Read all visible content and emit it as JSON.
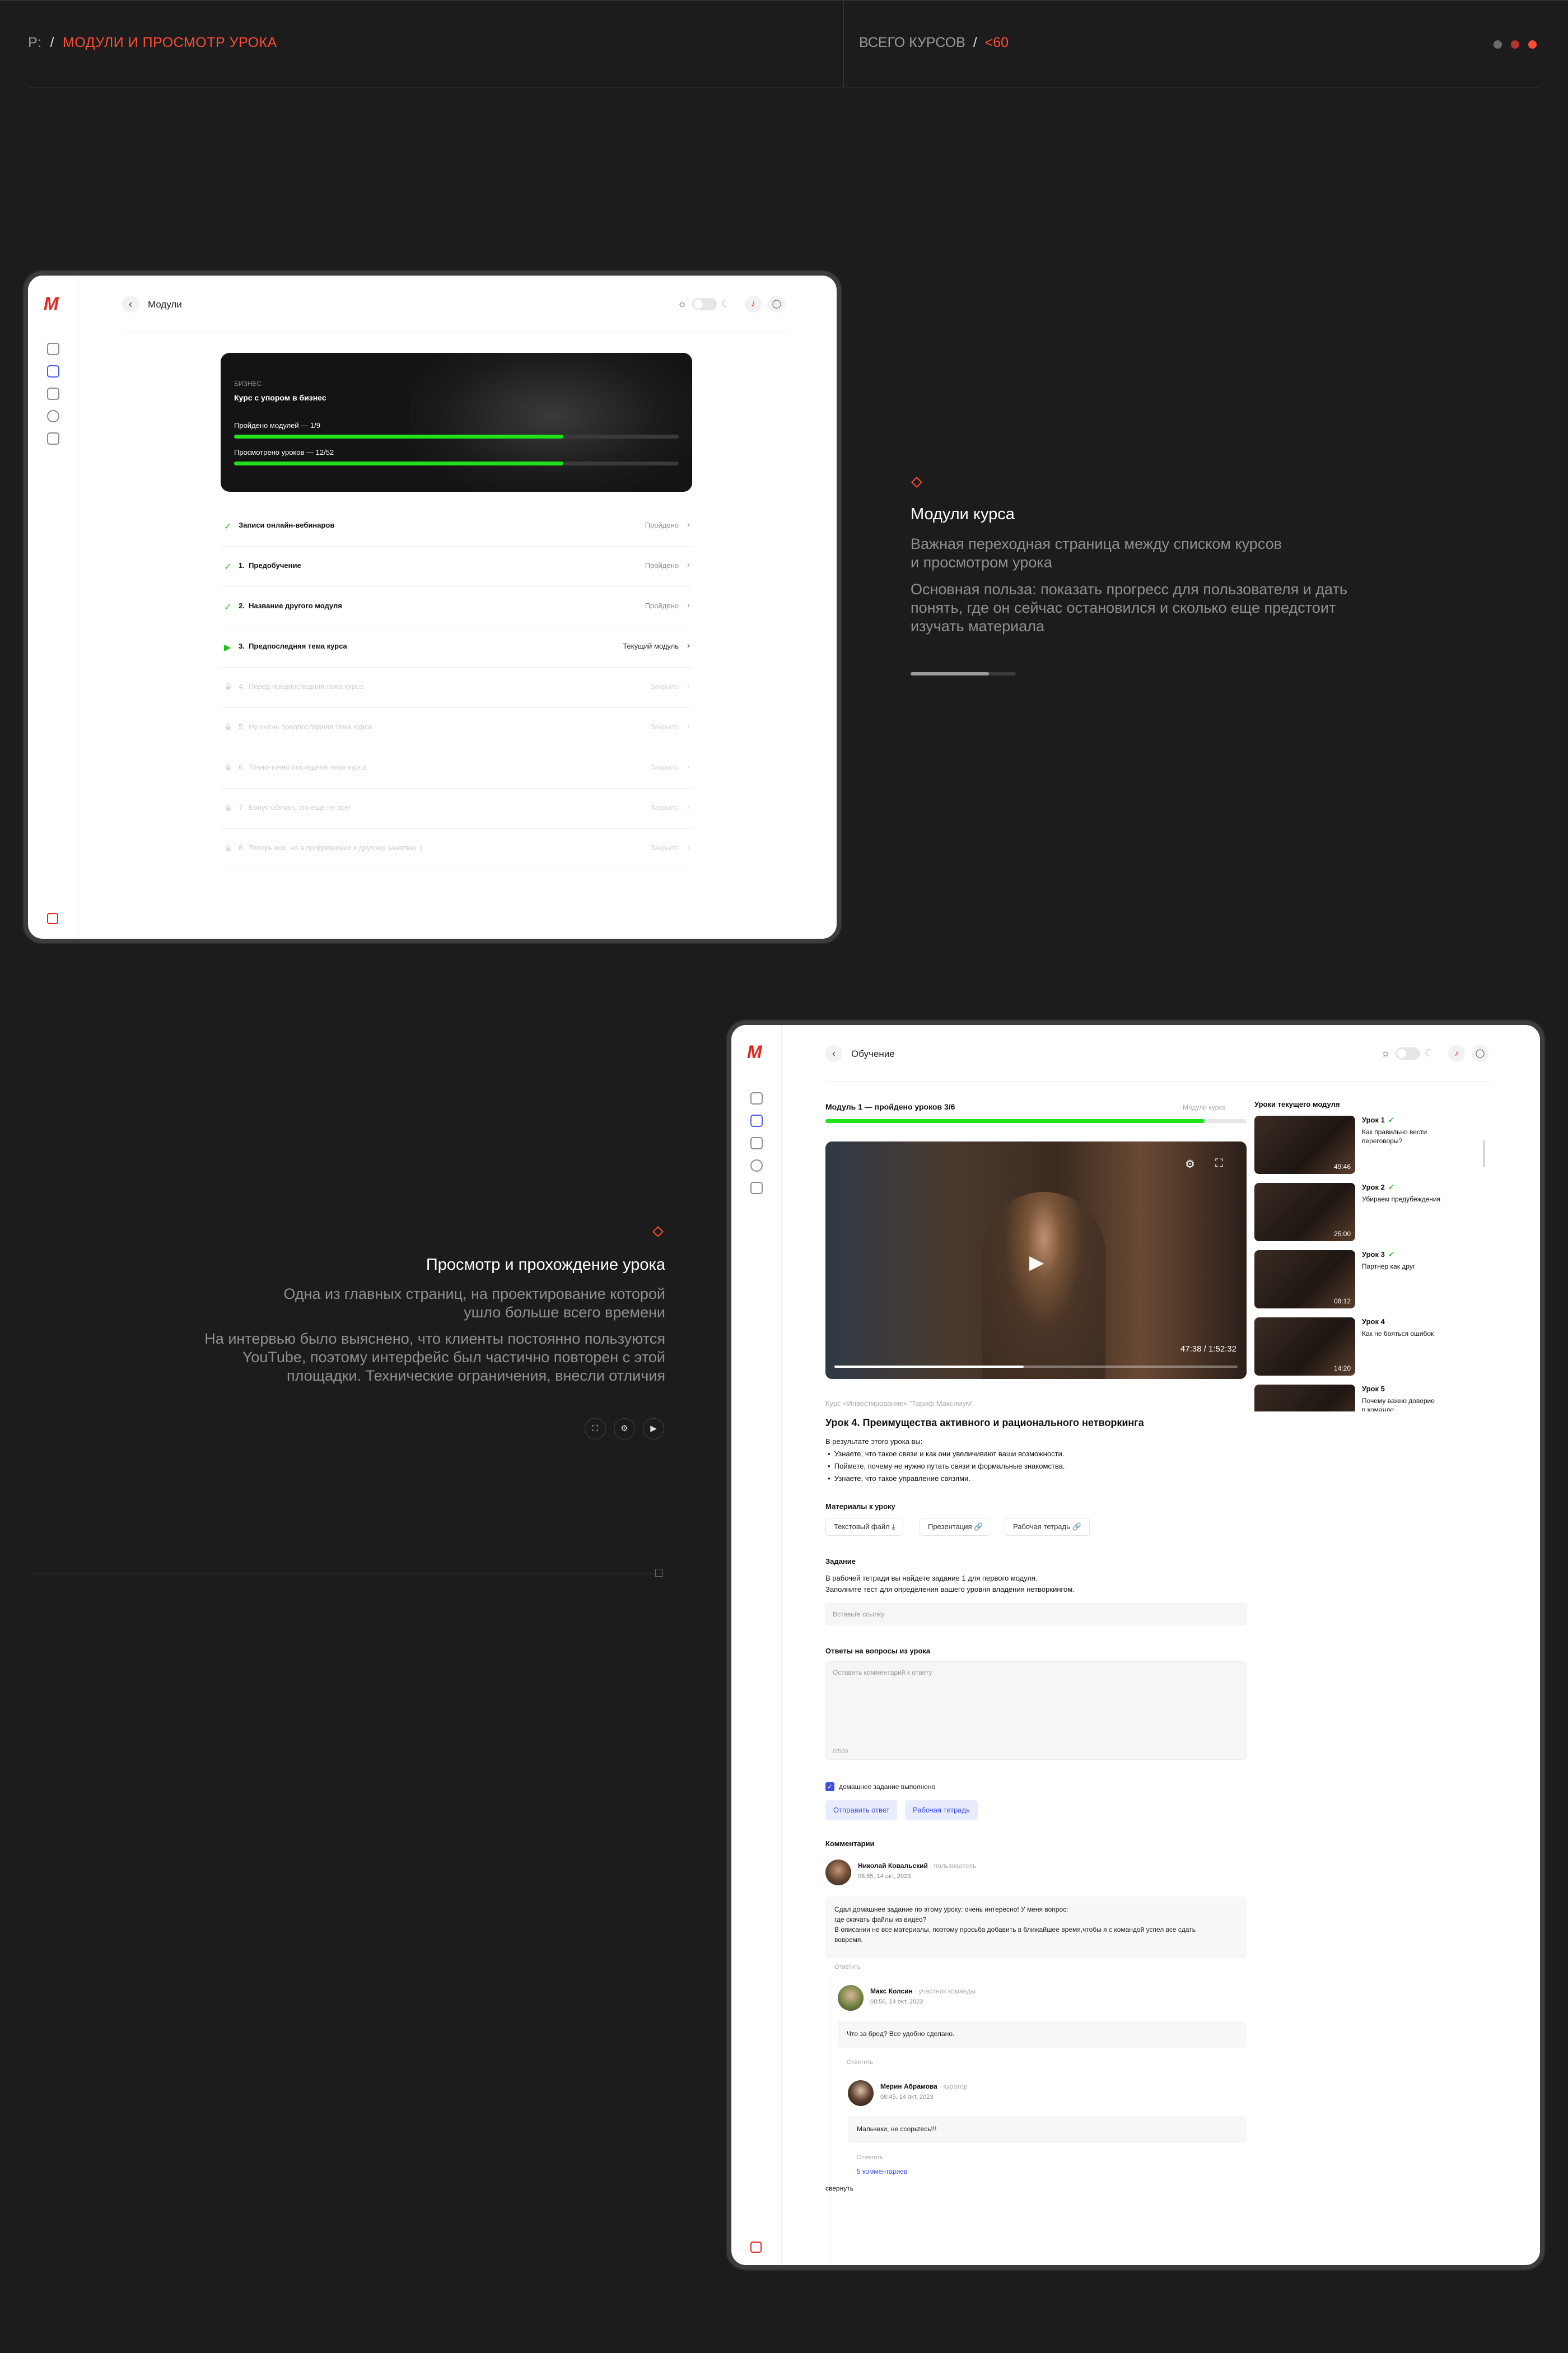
{
  "topbar": {
    "prefix": "P:",
    "sep1": "/",
    "section": "МОДУЛИ И ПРОСМОТР УРОКА",
    "courses_label": "ВСЕГО КУРСОВ",
    "sep2": "/",
    "courses_count": "<60",
    "dot_colors": [
      "#6b6b6b",
      "#b8322a",
      "#ff4b34"
    ]
  },
  "modules_screen": {
    "header_title": "Модули",
    "banner": {
      "category": "БИЗНЕС",
      "course_title": "Курс с упором в бизнес",
      "modules_progress_label": "Пройдено модулей — 1/9",
      "modules_progress_value": 0.74,
      "lessons_progress_label": "Просмотрено уроков — 12/52",
      "lessons_progress_value": 0.74
    },
    "modules": [
      {
        "num": "",
        "name": "Записи онлайн-вебинаров",
        "status": "Пройдено",
        "state": "done"
      },
      {
        "num": "1.",
        "name": "Предобучение",
        "status": "Пройдено",
        "state": "done"
      },
      {
        "num": "2.",
        "name": "Название другого модуля",
        "status": "Пройдено",
        "state": "done"
      },
      {
        "num": "3.",
        "name": "Предпоследняя тема курса",
        "status": "Текущий модуль",
        "state": "current"
      },
      {
        "num": "4.",
        "name": "Перед предпоследняя тема курса",
        "status": "Закрыто",
        "state": "locked"
      },
      {
        "num": "5.",
        "name": "Ну очень предпоследняя тема курса",
        "status": "Закрыто",
        "state": "locked"
      },
      {
        "num": "6.",
        "name": "Точно-точно последняя тема курса",
        "status": "Закрыто",
        "state": "locked"
      },
      {
        "num": "7.",
        "name": "Бонус обязан, это еще не все!",
        "status": "Закрыто",
        "state": "locked"
      },
      {
        "num": "8.",
        "name": "Теперь все, но в продолжение к другому занятию :)",
        "status": "Закрыто",
        "state": "locked"
      }
    ]
  },
  "modules_desc": {
    "title": "Модули курса",
    "line1": "Важная переходная страница между списком курсов",
    "line2": "и просмотром урока",
    "line3": "Основная польза: показать прогресс для пользователя и дать",
    "line4": "понять, где он сейчас остановился и сколько еще предстоит",
    "line5": "изучать материала"
  },
  "lesson_desc": {
    "title": "Просмотр и прохождение урока",
    "line1": "Одна из главных страниц, на проектирование которой",
    "line2": "ушло больше всего времени",
    "line3": "На интервью было выяснено, что клиенты постоянно пользуются",
    "line4": "YouTube, поэтому интерфейс был частично повторен с этой",
    "line5": "площадки. Технические ограничения, внесли отличия"
  },
  "lesson_screen": {
    "header_title": "Обучение",
    "module_progress_label": "Модуль 1 — пройдено уроков 3/6",
    "module_progress_value": 0.9,
    "module_link": "Модули курса",
    "video_time": "47:38 / 1:52:32",
    "video_progress_value": 0.47,
    "course_breadcrumb": "Курс «Инвестирование» \"Тариф Максимум\"",
    "lesson_title": "Урок 4. Преимущества активного и рационального нетворкинга",
    "intro": "В результате этого урока вы:",
    "bullets": [
      "Узнаете, что такое связи и как они увеличивают ваши возможности.",
      "Поймете, почему не нужно путать связи и формальные знакомства.",
      "Узнаете, что такое управление связями."
    ],
    "materials_title": "Материалы к уроку",
    "materials": [
      "Текстовый файл",
      "Презентация",
      "Рабочая тетрадь"
    ],
    "task_title": "Задание",
    "task_line1": "В рабочей тетради вы найдете задание 1 для первого модуля.",
    "task_line2": "Заполните тест для определения вашего уровня владения нетворкингом.",
    "link_placeholder": "Вставьте ссылку",
    "answers_title": "Ответы на вопросы из урока",
    "answer_placeholder": "Оставить комментарий к ответу",
    "answer_counter": "0/500",
    "homework_done": "домашнее задание выполнено",
    "send_button": "Отправить ответ",
    "workbook_button": "Рабочая тетрадь",
    "comments_title": "Комментарии",
    "comments": [
      {
        "author": "Николай Ковальский",
        "role": "· пользователь",
        "date": "08:55, 14 окт, 2023",
        "lines": [
          "Сдал домашнее задание по этому уроку: очень интересно! У меня вопрос:",
          "где скачать файлы из видео?",
          "В описании не все материалы, поэтому просьба добавить в ближайшее время,чтобы я с командой успел все сдать",
          "вовремя."
        ],
        "reply": "Ответить"
      },
      {
        "author": "Макс Колсин",
        "role": "· участник команды",
        "date": "08:56, 14 окт, 2023",
        "lines": [
          "Что за бред? Все удобно сделано."
        ],
        "reply": "Ответить"
      },
      {
        "author": "Мерин Абрамова",
        "role": "· куратор",
        "date": "08:45, 14 окт, 2023",
        "lines": [
          "Мальчики, не ссорьтесь!!!"
        ],
        "reply": "Ответить"
      }
    ],
    "more_comments": "5 комментариев",
    "collapse": "свернуть",
    "side_title": "Уроки текущего модуля",
    "lessons": [
      {
        "title": "Урок 1",
        "done": true,
        "desc1": "Как правильно вести",
        "desc2": "переговоры?",
        "time": "49:46"
      },
      {
        "title": "Урок 2",
        "done": true,
        "desc1": "Убираем предубеждения",
        "desc2": "",
        "time": "25:00"
      },
      {
        "title": "Урок 3",
        "done": true,
        "desc1": "Партнер как друг",
        "desc2": "",
        "time": "08:12"
      },
      {
        "title": "Урок 4",
        "done": false,
        "desc1": "Как не бояться ошибок",
        "desc2": "",
        "time": "14:20"
      },
      {
        "title": "Урок 5",
        "done": false,
        "desc1": "Почему важно доверие",
        "desc2": "в команде",
        "time": ""
      }
    ]
  }
}
